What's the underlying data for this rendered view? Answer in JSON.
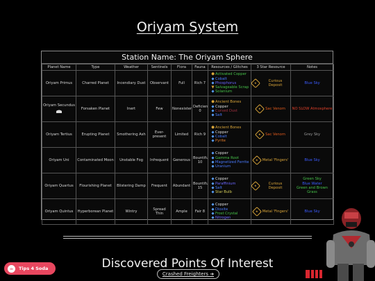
{
  "page": {
    "title": "Oriyam System"
  },
  "station": {
    "name": "Station Name: The Oriyam Sphere"
  },
  "table": {
    "headers": [
      "Planet Name",
      "Type",
      "Weather",
      "Sentinels",
      "Flora",
      "Fauna",
      "Resources / Glitches",
      "3 Star Resource",
      "Notes"
    ],
    "rows": [
      {
        "name": "Oriyam Primus",
        "type": "Charred Planet",
        "weather": "Incendiary Dust",
        "sentinels": "Observant",
        "flora": "Full",
        "fauna": "Rich 7",
        "resources": [
          {
            "icon": "glitch-icon",
            "text": "Activated Copper",
            "color": "#47c24a"
          },
          {
            "icon": "diamond-icon",
            "text": "Cobalt",
            "color": "#4a7bff"
          },
          {
            "icon": "diamond-icon",
            "text": "Phosphorus",
            "color": "#6b66ff"
          },
          {
            "icon": "shield-icon",
            "text": "Salvageable Scrap",
            "color": "#47c24a"
          },
          {
            "icon": "diamond-icon",
            "text": "Solanium",
            "color": "#47c24a"
          }
        ],
        "star": "Curious Deposit",
        "star_color": "#d9a53a",
        "notes": [
          {
            "text": "Blue Sky",
            "color": "#3c5cff"
          }
        ]
      },
      {
        "name": "Oriyam Secundus",
        "type": "Forsaken Planet",
        "weather": "Inert",
        "sentinels": "Few",
        "flora": "Nonexistent",
        "fauna": "Deficient 0",
        "resources": [
          {
            "icon": "glitch-icon",
            "text": "Ancient Bones",
            "color": "#d9a53a"
          },
          {
            "icon": "diamond-icon",
            "text": "Copper",
            "color": "#dddddd"
          },
          {
            "icon": "diamond-icon",
            "text": "Cursed Dust",
            "color": "#a03040"
          },
          {
            "icon": "diamond-icon",
            "text": "Salt",
            "color": "#4a7bff"
          }
        ],
        "star": "Sac Venom",
        "star_color": "#e05a1c",
        "notes": [
          {
            "text": "NO SLOW Atmosphere",
            "color": "#e0402a"
          }
        ]
      },
      {
        "name": "Oriyam Tertius",
        "type": "Erupting Planet",
        "weather": "Smothering Ash",
        "sentinels": "Ever-present",
        "flora": "Limited",
        "fauna": "Rich 9",
        "resources": [
          {
            "icon": "glitch-icon",
            "text": "Ancient Bones",
            "color": "#d9a53a"
          },
          {
            "icon": "diamond-icon",
            "text": "Copper",
            "color": "#dddddd"
          },
          {
            "icon": "diamond-icon",
            "text": "Cobalt",
            "color": "#4a7bff"
          },
          {
            "icon": "diamond-icon",
            "text": "Pyrite",
            "color": "#e07a2a"
          }
        ],
        "star": "Sac Venom",
        "star_color": "#e05a1c",
        "notes": [
          {
            "text": "Grey Sky",
            "color": "#9a9a9a"
          }
        ]
      },
      {
        "name": "Oriyam Uni",
        "type": "Contaminated Moon",
        "weather": "Unstable Fog",
        "sentinels": "Infrequent",
        "flora": "Generous",
        "fauna": "Bountiful 10",
        "resources": [
          {
            "icon": "diamond-icon",
            "text": "Copper",
            "color": "#dddddd"
          },
          {
            "icon": "diamond-icon",
            "text": "Gamma Root",
            "color": "#47c24a"
          },
          {
            "icon": "diamond-icon",
            "text": "Magnetized Ferrite",
            "color": "#4a7bff"
          },
          {
            "icon": "diamond-icon",
            "text": "Uranium",
            "color": "#4a7bff"
          }
        ],
        "star": "Metal 'Fingers'",
        "star_color": "#d9a53a",
        "notes": [
          {
            "text": "Blue Sky",
            "color": "#3c5cff"
          }
        ]
      },
      {
        "name": "Oriyam Quartus",
        "type": "Flourishing Planet",
        "weather": "Blistering Damp",
        "sentinels": "Frequent",
        "flora": "Abundant",
        "fauna": "Bountiful 15",
        "resources": [
          {
            "icon": "diamond-icon",
            "text": "Copper",
            "color": "#dddddd"
          },
          {
            "icon": "diamond-icon",
            "text": "Paraffinium",
            "color": "#6b66ff"
          },
          {
            "icon": "diamond-icon",
            "text": "Salt",
            "color": "#4a7bff"
          },
          {
            "icon": "diamond-icon",
            "text": "Star Bulb",
            "color": "#d8d05a"
          }
        ],
        "star": "Curious Deposit",
        "star_color": "#d9a53a",
        "notes": [
          {
            "text": "Green Sky",
            "color": "#47c24a"
          },
          {
            "text": "Blue Water",
            "color": "#3c5cff"
          },
          {
            "text": "Green and Brown Grass",
            "color": "#47c24a"
          }
        ]
      },
      {
        "name": "Oriyam Quintus",
        "type": "Hyperborean Planet",
        "weather": "Wintry",
        "sentinels": "Spread Thin",
        "flora": "Ample",
        "fauna": "Fair 8",
        "resources": [
          {
            "icon": "diamond-icon",
            "text": "Copper",
            "color": "#dddddd"
          },
          {
            "icon": "diamond-icon",
            "text": "Dioxite",
            "color": "#4a7bff"
          },
          {
            "icon": "diamond-icon",
            "text": "Frost Crystal",
            "color": "#47c24a"
          },
          {
            "icon": "diamond-icon",
            "text": "Nitrogen",
            "color": "#6b66ff"
          }
        ],
        "star": "Metal 'Fingers'",
        "star_color": "#d9a53a",
        "notes": [
          {
            "text": "Blue Sky",
            "color": "#3c5cff"
          }
        ]
      }
    ]
  },
  "footer": {
    "section_title": "Discovered Points Of Interest",
    "link_label": "Crashed Freighters"
  },
  "tips_button": {
    "label": "Tips 4 Soda",
    "color": "#e8475f"
  }
}
